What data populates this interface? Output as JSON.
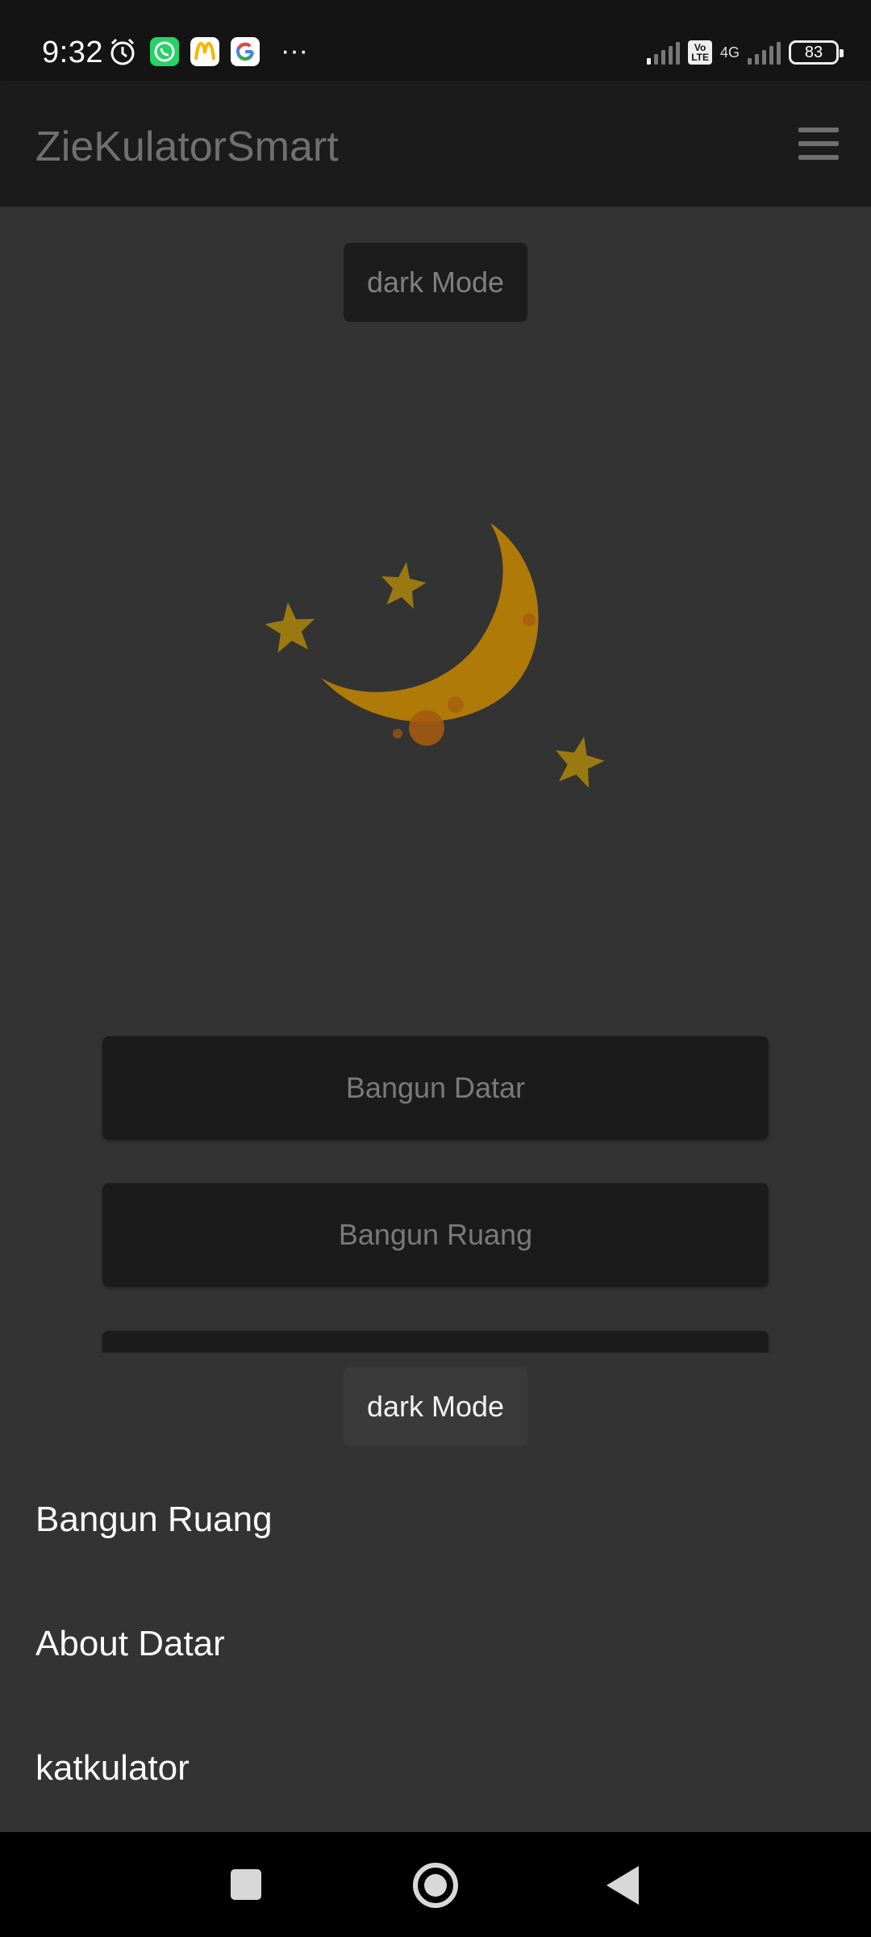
{
  "status_bar": {
    "time": "9:32",
    "more": "···",
    "volte": "Vo\nLTE",
    "network": "4G",
    "battery": "83",
    "icons": [
      "alarm-icon",
      "whatsapp-icon",
      "mcdonalds-icon",
      "google-icon"
    ]
  },
  "app_bar": {
    "title": "ZieKulatorSmart",
    "menu_icon": "hamburger-menu-icon"
  },
  "main": {
    "mode_button": "dark Mode",
    "illustration": "moon-and-stars",
    "buttons": [
      "Bangun Datar",
      "Bangun Ruang",
      ""
    ]
  },
  "drawer": {
    "mode_button": "dark Mode",
    "items": [
      "Bangun Ruang",
      "About Datar",
      "katkulator"
    ]
  },
  "colors": {
    "app_bar": "#1b1b1b",
    "content_bg": "#333333",
    "button_bg": "#1b1b1b",
    "moon": "#b07a08",
    "star": "#9a7a10"
  }
}
